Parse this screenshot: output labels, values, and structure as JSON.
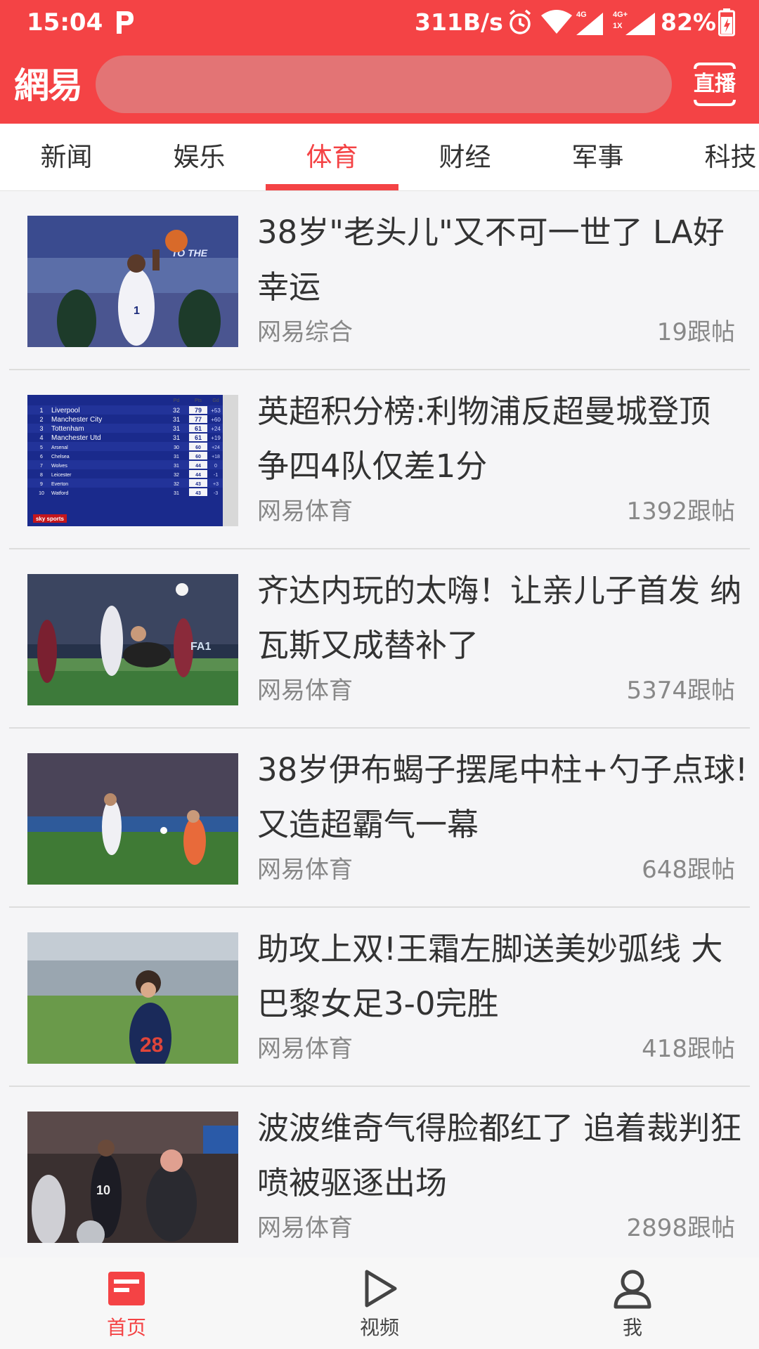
{
  "status_bar": {
    "time": "15:04",
    "network_speed": "311B/s",
    "battery": "82%",
    "icons": [
      "p-app-icon",
      "alarm-icon",
      "wifi-icon",
      "signal-4g-icon",
      "signal-4g-1x-icon",
      "battery-charging-icon"
    ],
    "network_labels": [
      "4G",
      "4G+",
      "1X"
    ]
  },
  "header": {
    "logo": "網易",
    "search_placeholder": "",
    "live_label": "直播",
    "background_color": "#f44345"
  },
  "tabs": [
    {
      "label": "新闻",
      "active": false
    },
    {
      "label": "娱乐",
      "active": false
    },
    {
      "label": "体育",
      "active": true
    },
    {
      "label": "财经",
      "active": false
    },
    {
      "label": "军事",
      "active": false
    },
    {
      "label": "科技",
      "active": false
    }
  ],
  "news": [
    {
      "title": "38岁\"老头儿\"又不可一世了 LA好幸运",
      "source": "网易综合",
      "comments": "19跟帖",
      "thumb": "basketball-dunk"
    },
    {
      "title": "英超积分榜:利物浦反超曼城登顶 争四4队仅差1分",
      "source": "网易体育",
      "comments": "1392跟帖",
      "thumb": "league-table"
    },
    {
      "title": "齐达内玩的太嗨！让亲儿子首发 纳瓦斯又成替补了",
      "source": "网易体育",
      "comments": "5374跟帖",
      "thumb": "goalkeeper-save"
    },
    {
      "title": "38岁伊布蝎子摆尾中柱+勺子点球!又造超霸气一幕",
      "source": "网易体育",
      "comments": "648跟帖",
      "thumb": "penalty-kick"
    },
    {
      "title": "助攻上双!王霜左脚送美妙弧线 大巴黎女足3-0完胜",
      "source": "网易体育",
      "comments": "418跟帖",
      "thumb": "womens-football"
    },
    {
      "title": "波波维奇气得脸都红了 追着裁判狂喷被驱逐出场",
      "source": "网易体育",
      "comments": "2898跟帖",
      "thumb": "basketball-coach"
    }
  ],
  "league_table": {
    "header": [
      "Pd",
      "Pts",
      "Gd"
    ],
    "rows": [
      {
        "pos": "1",
        "team": "Liverpool",
        "pd": "32",
        "pts": "79",
        "gd": "+53"
      },
      {
        "pos": "2",
        "team": "Manchester City",
        "pd": "31",
        "pts": "77",
        "gd": "+60"
      },
      {
        "pos": "3",
        "team": "Tottenham",
        "pd": "31",
        "pts": "61",
        "gd": "+24"
      },
      {
        "pos": "4",
        "team": "Manchester Utd",
        "pd": "31",
        "pts": "61",
        "gd": "+19"
      },
      {
        "pos": "5",
        "team": "Arsenal",
        "pd": "30",
        "pts": "60",
        "gd": "+24"
      },
      {
        "pos": "6",
        "team": "Chelsea",
        "pd": "31",
        "pts": "60",
        "gd": "+18"
      },
      {
        "pos": "7",
        "team": "Wolves",
        "pd": "31",
        "pts": "44",
        "gd": "0"
      },
      {
        "pos": "8",
        "team": "Leicester",
        "pd": "32",
        "pts": "44",
        "gd": "-1"
      },
      {
        "pos": "9",
        "team": "Everton",
        "pd": "32",
        "pts": "43",
        "gd": "+3"
      },
      {
        "pos": "10",
        "team": "Watford",
        "pd": "31",
        "pts": "43",
        "gd": "-3"
      }
    ],
    "brand": "sky sports"
  },
  "bottom_nav": [
    {
      "label": "首页",
      "icon": "home-news-icon",
      "active": true
    },
    {
      "label": "视频",
      "icon": "play-icon",
      "active": false
    },
    {
      "label": "我",
      "icon": "user-icon",
      "active": false
    }
  ]
}
